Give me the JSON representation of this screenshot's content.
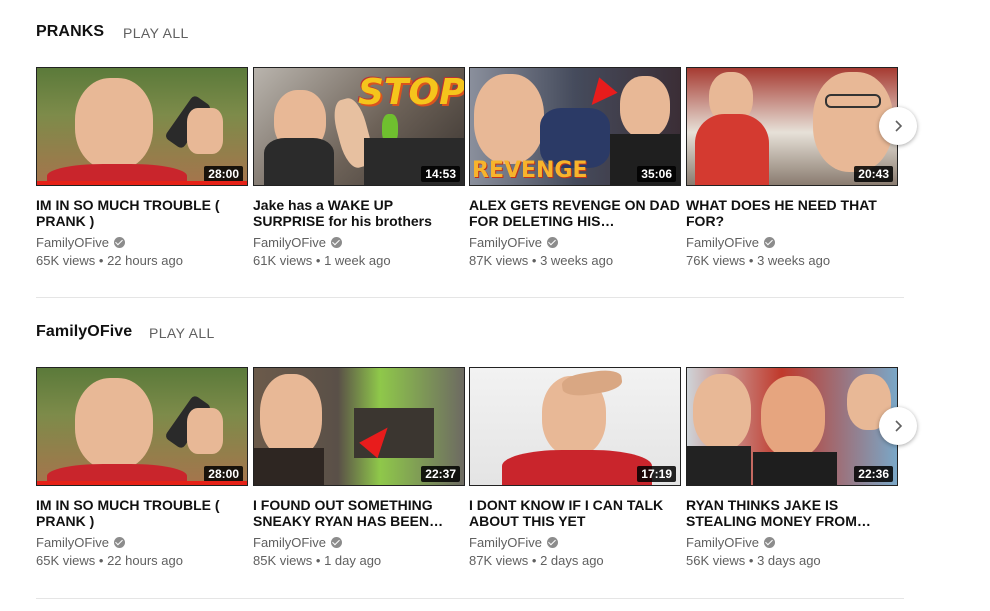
{
  "shelves": [
    {
      "title": "PRANKS",
      "play_all": "PLAY ALL",
      "videos": [
        {
          "title": "IM IN SO MUCH TROUBLE ( PRANK )",
          "channel": "FamilyOFive",
          "views": "65K views",
          "age": "22 hours ago",
          "duration": "28:00",
          "watched": 1.0
        },
        {
          "title": "Jake has a WAKE UP SURPRISE for his brothers",
          "channel": "FamilyOFive",
          "views": "61K views",
          "age": "1 week ago",
          "duration": "14:53",
          "thumb_text": "STOP!"
        },
        {
          "title": "ALEX GETS REVENGE ON DAD FOR DELETING HIS…",
          "channel": "FamilyOFive",
          "views": "87K views",
          "age": "3 weeks ago",
          "duration": "35:06",
          "thumb_text": "REVENGE"
        },
        {
          "title": "WHAT DOES HE NEED THAT FOR?",
          "channel": "FamilyOFive",
          "views": "76K views",
          "age": "3 weeks ago",
          "duration": "20:43"
        }
      ]
    },
    {
      "title": "FamilyOFive",
      "play_all": "PLAY ALL",
      "videos": [
        {
          "title": "IM IN SO MUCH TROUBLE ( PRANK )",
          "channel": "FamilyOFive",
          "views": "65K views",
          "age": "22 hours ago",
          "duration": "28:00",
          "watched": 1.0
        },
        {
          "title": "I FOUND OUT SOMETHING SNEAKY RYAN HAS BEEN…",
          "channel": "FamilyOFive",
          "views": "85K views",
          "age": "1 day ago",
          "duration": "22:37"
        },
        {
          "title": "I DONT KNOW IF I CAN TALK ABOUT THIS YET",
          "channel": "FamilyOFive",
          "views": "87K views",
          "age": "2 days ago",
          "duration": "17:19"
        },
        {
          "title": "RYAN THINKS JAKE IS STEALING MONEY FROM…",
          "channel": "FamilyOFive",
          "views": "56K views",
          "age": "3 days ago",
          "duration": "22:36"
        }
      ]
    }
  ],
  "meta_separator": "•",
  "icons": {
    "verified": "verified-check-icon",
    "next": "chevron-right-icon"
  },
  "colors": {
    "progress": "#e62117",
    "meta_text": "#606060"
  }
}
